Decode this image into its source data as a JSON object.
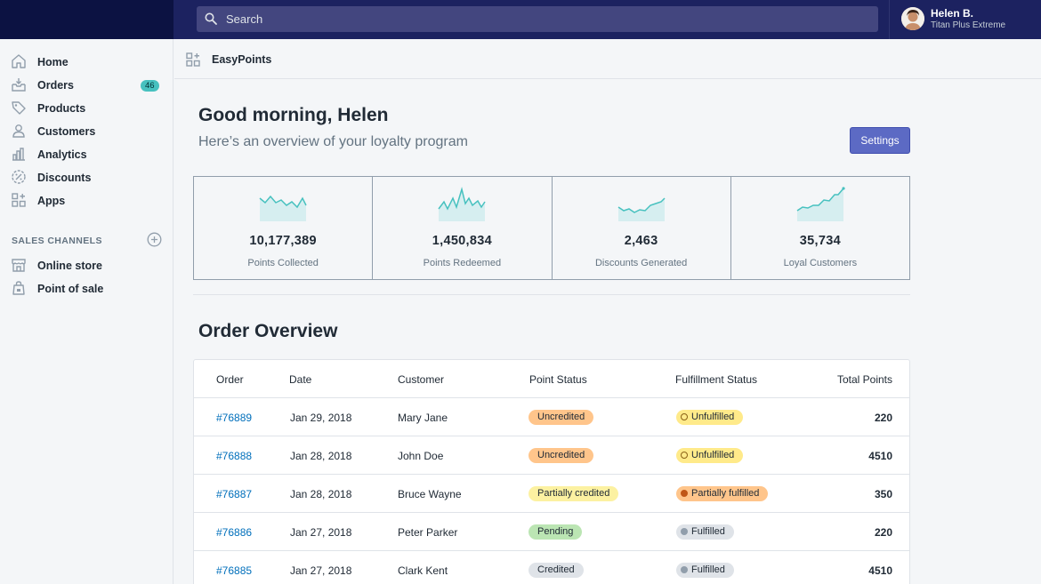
{
  "search": {
    "placeholder": "Search"
  },
  "user": {
    "name": "Helen B.",
    "store": "Titan Plus Extreme"
  },
  "sidebar": {
    "items": [
      {
        "label": "Home",
        "icon": "home-icon"
      },
      {
        "label": "Orders",
        "icon": "orders-icon",
        "badge": "46"
      },
      {
        "label": "Products",
        "icon": "tag-icon"
      },
      {
        "label": "Customers",
        "icon": "person-icon"
      },
      {
        "label": "Analytics",
        "icon": "bar-chart-icon"
      },
      {
        "label": "Discounts",
        "icon": "discount-icon"
      },
      {
        "label": "Apps",
        "icon": "apps-icon"
      }
    ],
    "section_heading": "SALES CHANNELS",
    "channels": [
      {
        "label": "Online store",
        "icon": "store-icon"
      },
      {
        "label": "Point of sale",
        "icon": "pos-bag-icon"
      }
    ]
  },
  "appbar": {
    "title": "EasyPoints"
  },
  "greeting": {
    "title": "Good morning, Helen",
    "subtitle": "Here’s an overview of your loyalty program"
  },
  "settings_label": "Settings",
  "stats": [
    {
      "value": "10,177,389",
      "caption": "Points Collected"
    },
    {
      "value": "1,450,834",
      "caption": "Points Redeemed"
    },
    {
      "value": "2,463",
      "caption": "Discounts Generated"
    },
    {
      "value": "35,734",
      "caption": "Loyal Customers"
    }
  ],
  "order_overview": {
    "title": "Order Overview",
    "columns": [
      "Order",
      "Date",
      "Customer",
      "Point Status",
      "Fulfillment Status",
      "Total Points"
    ],
    "rows": [
      {
        "order": "#76889",
        "date": "Jan 29, 2018",
        "customer": "Mary Jane",
        "point_status": "Uncredited",
        "fulfillment": "Unfulfilled",
        "total": "220"
      },
      {
        "order": "#76888",
        "date": "Jan 28, 2018",
        "customer": "John Doe",
        "point_status": "Uncredited",
        "fulfillment": "Unfulfilled",
        "total": "4510"
      },
      {
        "order": "#76887",
        "date": "Jan 28, 2018",
        "customer": "Bruce Wayne",
        "point_status": "Partially credited",
        "fulfillment": "Partially fulfilled",
        "total": "350"
      },
      {
        "order": "#76886",
        "date": "Jan 27, 2018",
        "customer": "Peter Parker",
        "point_status": "Pending",
        "fulfillment": "Fulfilled",
        "total": "220"
      },
      {
        "order": "#76885",
        "date": "Jan 27, 2018",
        "customer": "Clark Kent",
        "point_status": "Credited",
        "fulfillment": "Fulfilled",
        "total": "4510"
      }
    ]
  },
  "colors": {
    "topbar": "#1c2260",
    "accent": "#5c6ac4",
    "sparkline": "#47c1bf",
    "link": "#006fbb",
    "badge": "#47c1bf"
  }
}
